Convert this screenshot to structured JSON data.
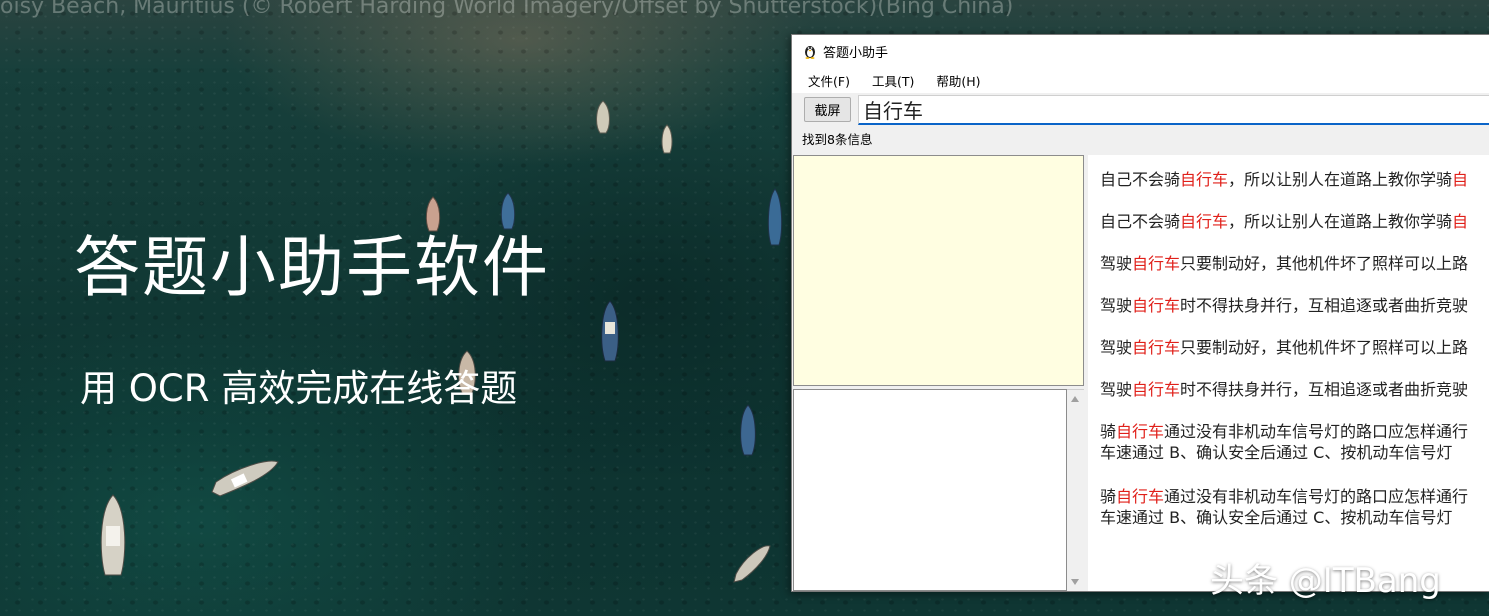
{
  "background": {
    "caption": "oisy Beach, Mauritius (© Robert Harding World Imagery/Offset by Shutterstock)(Bing China)",
    "headline": "答题小助手软件",
    "subheadline": "用 OCR 高效完成在线答题",
    "watermark": "头条 @ITBang"
  },
  "window": {
    "title": "答题小助手",
    "app_icon": "penguin-icon",
    "menu": [
      "文件(F)",
      "工具(T)",
      "帮助(H)"
    ],
    "capture_button": "截屏",
    "search_value": "自行车",
    "result_count": "找到8条信息",
    "highlight_color": "#e0201a",
    "image_panel_color": "#fffee1",
    "results": [
      {
        "lines": [
          [
            "自己不会骑",
            ""
          ],
          [
            "自行车",
            "hl"
          ],
          [
            "，所以让别人在道路上教你学骑",
            ""
          ],
          [
            "自",
            "hl"
          ]
        ]
      },
      {
        "lines": [
          [
            "自己不会骑",
            ""
          ],
          [
            "自行车",
            "hl"
          ],
          [
            "，所以让别人在道路上教你学骑",
            ""
          ],
          [
            "自",
            "hl"
          ]
        ]
      },
      {
        "lines": [
          [
            "驾驶",
            ""
          ],
          [
            "自行车",
            "hl"
          ],
          [
            "只要制动好，其他机件坏了照样可以上路",
            ""
          ]
        ]
      },
      {
        "lines": [
          [
            "驾驶",
            ""
          ],
          [
            "自行车",
            "hl"
          ],
          [
            "时不得扶身并行，互相追逐或者曲折竞驶",
            ""
          ]
        ]
      },
      {
        "lines": [
          [
            "驾驶",
            ""
          ],
          [
            "自行车",
            "hl"
          ],
          [
            "只要制动好，其他机件坏了照样可以上路",
            ""
          ]
        ]
      },
      {
        "lines": [
          [
            "驾驶",
            ""
          ],
          [
            "自行车",
            "hl"
          ],
          [
            "时不得扶身并行，互相追逐或者曲折竞驶",
            ""
          ]
        ]
      },
      {
        "lines": [
          [
            "骑",
            ""
          ],
          [
            "自行车",
            "hl"
          ],
          [
            "通过没有非机动车信号灯的路口应怎样通行",
            ""
          ]
        ],
        "line2": "车速通过 B、确认安全后通过 C、按机动车信号灯"
      },
      {
        "lines": [
          [
            "骑",
            ""
          ],
          [
            "自行车",
            "hl"
          ],
          [
            "通过没有非机动车信号灯的路口应怎样通行",
            ""
          ]
        ],
        "line2": "车速通过 B、确认安全后通过 C、按机动车信号灯"
      }
    ]
  }
}
